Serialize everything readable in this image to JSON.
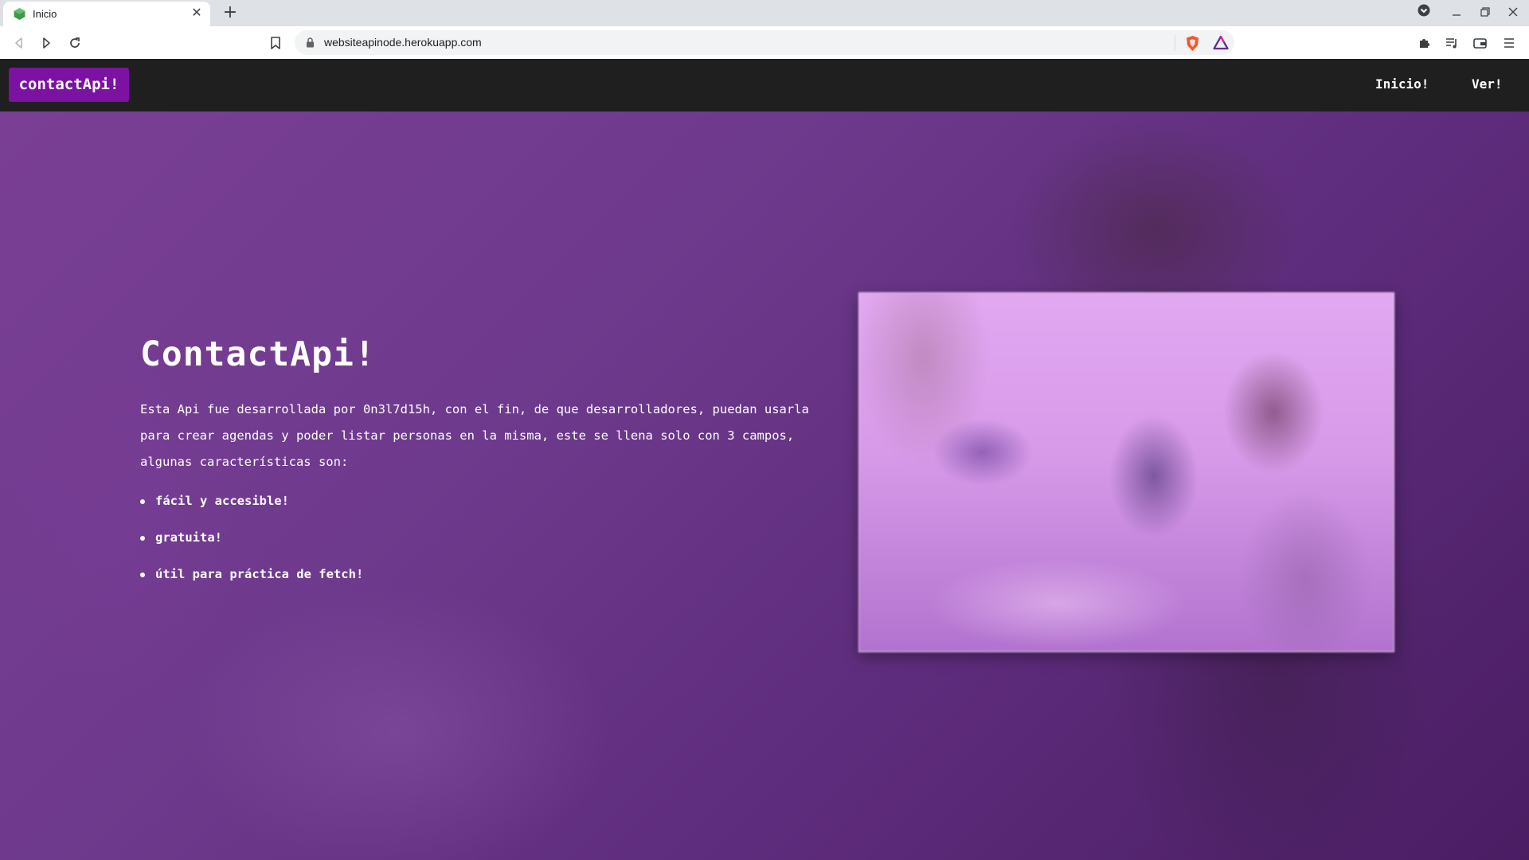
{
  "browser": {
    "tab": {
      "title": "Inicio"
    },
    "url": "websiteapinode.herokuapp.com"
  },
  "navbar": {
    "brand": "contactApi!",
    "links": [
      "Inicio!",
      "Ver!"
    ]
  },
  "hero": {
    "title": "ContactApi!",
    "description": "Esta Api fue desarrollada por 0n3l7d15h, con el fin, de que desarrolladores, puedan usarla para crear agendas y poder listar personas en la misma, este se llena solo con 3 campos, algunas características son:",
    "features": [
      "fácil y accesible!",
      "gratuita!",
      "útil para práctica de fetch!"
    ]
  },
  "colors": {
    "brand_button": "#7b12a1",
    "navbar_bg": "#1f1f1f",
    "hero_overlay": "#6e3a8d"
  },
  "icons": [
    "favicon-cube-icon",
    "close-icon",
    "plus-icon",
    "back-icon",
    "forward-icon",
    "reload-icon",
    "bookmark-icon",
    "lock-icon",
    "brave-shield-icon",
    "brave-rewards-icon",
    "extensions-icon",
    "playlist-icon",
    "wallet-icon",
    "menu-icon"
  ]
}
